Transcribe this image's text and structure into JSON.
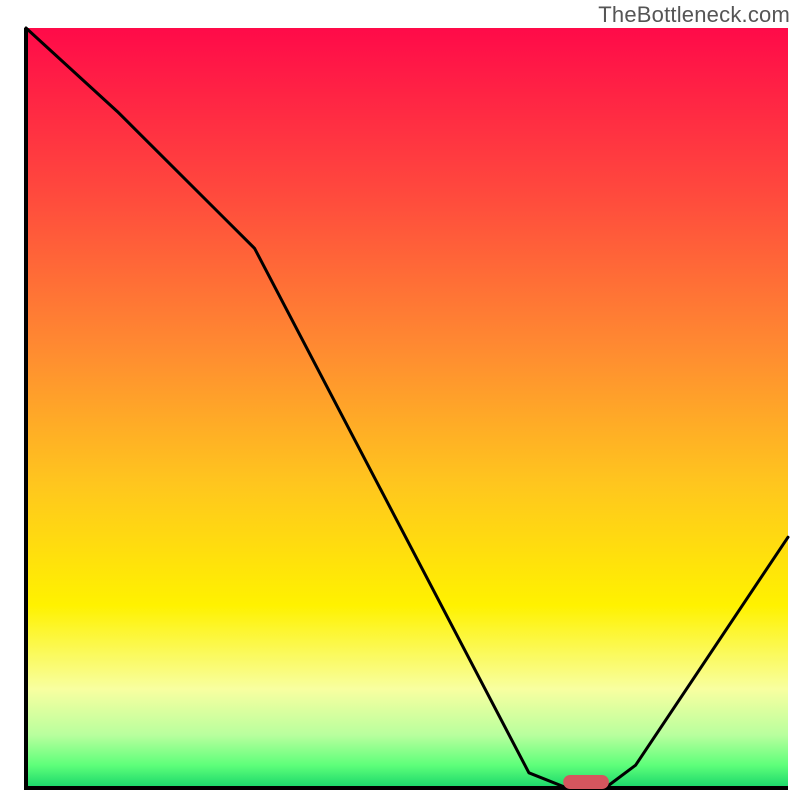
{
  "watermark": "TheBottleneck.com",
  "chart_data": {
    "type": "line",
    "title": "",
    "xlabel": "",
    "ylabel": "",
    "xlim": [
      0,
      100
    ],
    "ylim": [
      0,
      100
    ],
    "grid": false,
    "legend": false,
    "annotations": [],
    "notes": "Background is a vertical rainbow gradient (red→orange→yellow→green) drawn inside the plot area. A single black V-shaped curve overlays it. A small red marker sits at the trough. Axes are unlabeled black borders.",
    "background_gradient_stops": [
      {
        "offset": 0.0,
        "color": "#ff0a49"
      },
      {
        "offset": 0.22,
        "color": "#ff4a3d"
      },
      {
        "offset": 0.42,
        "color": "#ff8a31"
      },
      {
        "offset": 0.6,
        "color": "#ffc61e"
      },
      {
        "offset": 0.76,
        "color": "#fff200"
      },
      {
        "offset": 0.87,
        "color": "#f8ffa0"
      },
      {
        "offset": 0.93,
        "color": "#b9ff9e"
      },
      {
        "offset": 0.97,
        "color": "#5eff7a"
      },
      {
        "offset": 1.0,
        "color": "#18d66a"
      }
    ],
    "series": [
      {
        "name": "bottleneck-curve",
        "color": "#000000",
        "x": [
          0,
          12,
          26,
          30,
          66,
          71,
          76,
          80,
          100
        ],
        "y": [
          100,
          89,
          75,
          71,
          2,
          0,
          0,
          3,
          33
        ]
      }
    ],
    "marker": {
      "name": "optimal-point",
      "x": 73.5,
      "width_pct": 6,
      "color": "#d4565e"
    }
  }
}
